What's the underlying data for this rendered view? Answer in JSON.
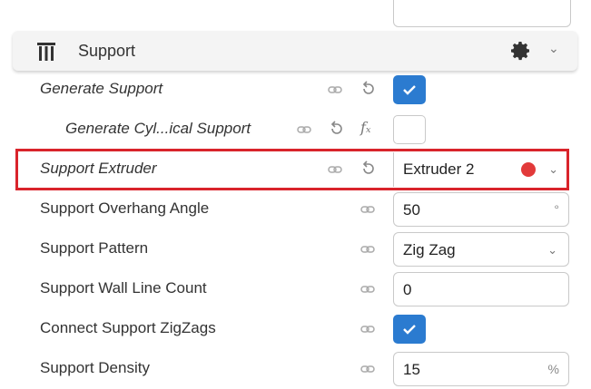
{
  "section": {
    "title": "Support",
    "icon": "support-category-icon",
    "settings_icon": "gear-icon",
    "collapse_icon": "chevron-down-icon"
  },
  "settings": [
    {
      "label": "Generate Support",
      "style": "italic",
      "control": "checkbox",
      "checked": true,
      "linked": true,
      "resettable": true
    },
    {
      "label": "Generate Cyl...ical Support",
      "style": "italic",
      "control": "checkbox",
      "checked": false,
      "linked": true,
      "resettable": true,
      "has_formula": true
    },
    {
      "label": "Support Extruder",
      "style": "italic",
      "control": "dropdown",
      "value": "Extruder 2",
      "extruder_color": "#e23a3a",
      "linked": true,
      "resettable": true,
      "highlighted": true
    },
    {
      "label": "Support Overhang Angle",
      "control": "number",
      "value": "50",
      "unit": "°",
      "linked": true
    },
    {
      "label": "Support Pattern",
      "control": "dropdown",
      "value": "Zig Zag",
      "linked": true
    },
    {
      "label": "Support Wall Line Count",
      "control": "number",
      "value": "0",
      "linked": true
    },
    {
      "label": "Connect Support ZigZags",
      "control": "checkbox",
      "checked": true,
      "linked": true
    },
    {
      "label": "Support Density",
      "control": "number",
      "value": "15",
      "unit": "%",
      "linked": true
    }
  ],
  "formula_symbol": "fₓ",
  "colors": {
    "accent": "#2b7bd0",
    "highlight": "#d9242b"
  }
}
